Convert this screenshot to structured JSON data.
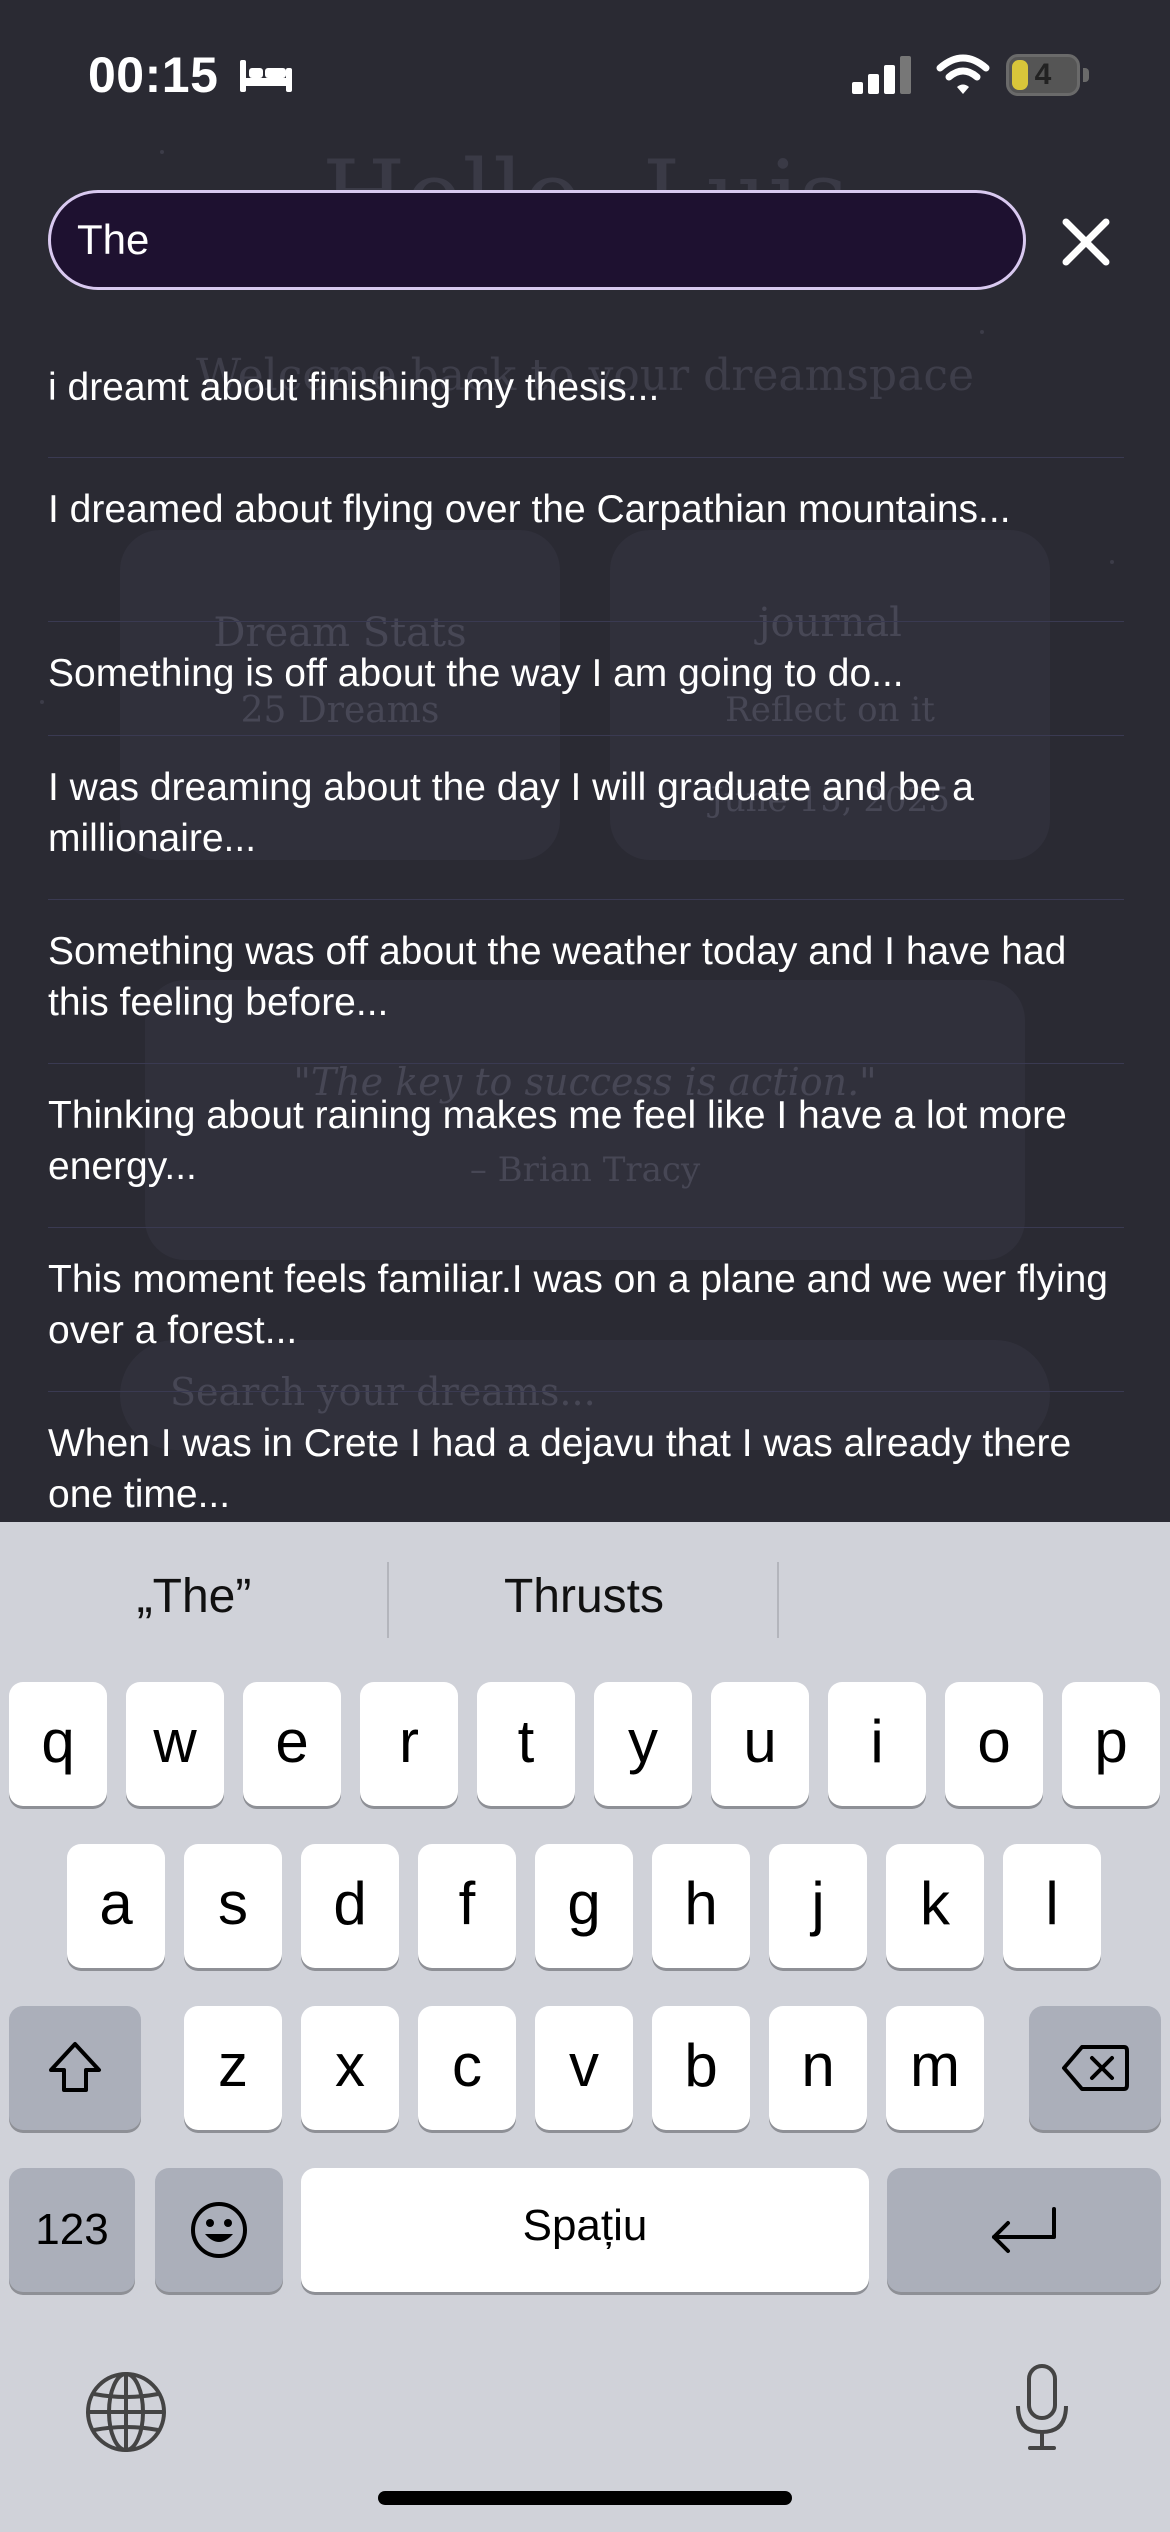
{
  "status_bar": {
    "time": "00:15",
    "battery_level": "4"
  },
  "search": {
    "value": "The"
  },
  "results": [
    "i dreamt about finishing my thesis...",
    "I dreamed about flying over the Carpathian mountains...",
    "Something is off about the way I am going to do...",
    "I was dreaming about the day I will graduate and be a millionaire...",
    "Something was off about the weather today and I have had this feeling before...",
    "Thinking about raining makes me feel like I have a lot more energy...",
    "This moment feels familiar.I was on a plane and we wer flying over a forest...",
    "When I was in Crete I had a dejavu that I was already there one time..."
  ],
  "background_app": {
    "greeting": "Hello, Luis",
    "subtitle": "Welcome back to your dreamspace",
    "dream_stats": {
      "title": "Dream Stats",
      "count": "25 Dreams"
    },
    "journal": {
      "title": "journal",
      "prompt": "Reflect on it",
      "date": "June 15, 2025"
    },
    "quote": {
      "text": "\"The key to success is action.\"",
      "author": "– Brian Tracy"
    },
    "search_placeholder": "Search your dreams..."
  },
  "keyboard": {
    "suggestions": [
      "„The”",
      "Thrusts",
      ""
    ],
    "rows": [
      [
        "q",
        "w",
        "e",
        "r",
        "t",
        "y",
        "u",
        "i",
        "o",
        "p"
      ],
      [
        "a",
        "s",
        "d",
        "f",
        "g",
        "h",
        "j",
        "k",
        "l"
      ],
      [
        "z",
        "x",
        "c",
        "v",
        "b",
        "n",
        "m"
      ]
    ],
    "numbers_label": "123",
    "space_label": "Spațiu"
  },
  "colors": {
    "search_bg": "#1e1130",
    "search_border": "#d9c9f0",
    "keyboard_bg": "#d0d2d9"
  }
}
